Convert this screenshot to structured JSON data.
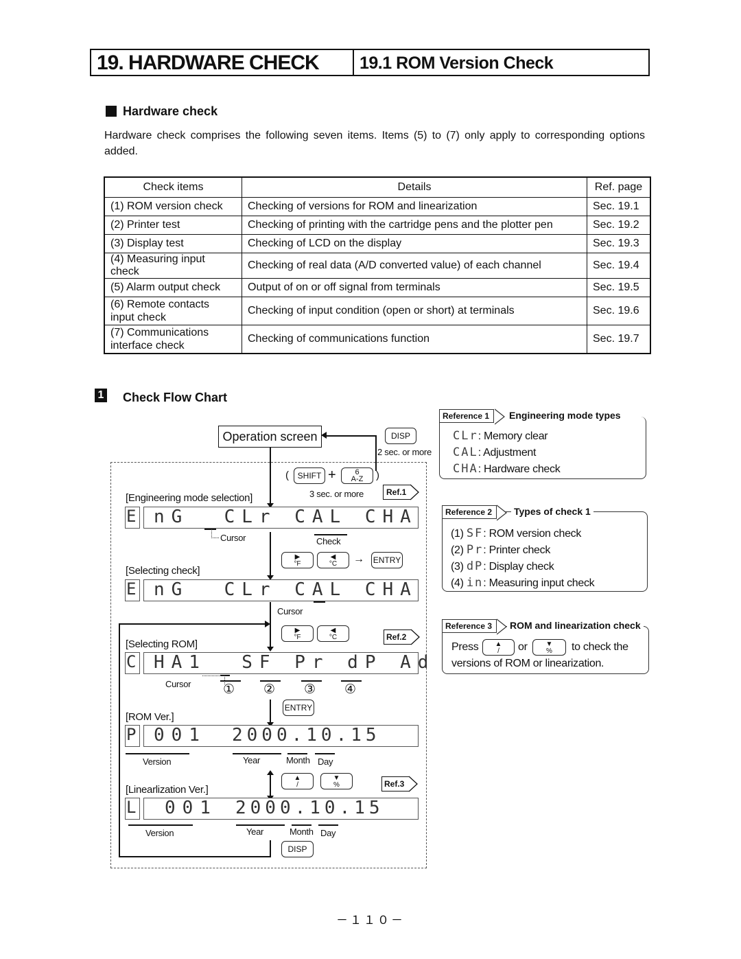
{
  "header": {
    "chapter": "19. HARDWARE CHECK",
    "section": "19.1 ROM Version Check"
  },
  "hardware_check": {
    "heading": "Hardware check",
    "paragraph": "Hardware check comprises the following seven items. Items (5) to (7) only apply to corresponding options added."
  },
  "table": {
    "headers": [
      "Check items",
      "Details",
      "Ref. page"
    ],
    "rows": [
      {
        "item": "(1) ROM version check",
        "details": "Checking of versions for ROM and linearization",
        "ref": "Sec. 19.1"
      },
      {
        "item": "(2) Printer test",
        "details": "Checking of printing with the cartridge pens and the plotter pen",
        "ref": "Sec. 19.2"
      },
      {
        "item": "(3) Display test",
        "details": "Checking of LCD on the display",
        "ref": "Sec. 19.3"
      },
      {
        "item": "(4) Measuring input check",
        "details": "Checking of real data (A/D converted value) of each channel",
        "ref": "Sec. 19.4"
      },
      {
        "item": "(5) Alarm output check",
        "details": "Output of on or off signal from terminals",
        "ref": "Sec. 19.5"
      },
      {
        "item": "(6) Remote contacts input check",
        "details": "Checking of input condition (open or short) at terminals",
        "ref": "Sec. 19.6"
      },
      {
        "item": "(7) Communications interface check",
        "details": "Checking of communications function",
        "ref": "Sec. 19.7"
      }
    ]
  },
  "flow": {
    "section_number": "1",
    "heading": "Check Flow Chart",
    "operation_screen": "Operation screen",
    "disp_key": "DISP",
    "two_sec": "2 sec. or more",
    "shift_key": "SHIFT",
    "plus": "+",
    "az_key_top": "6",
    "az_key_bottom": "A-Z",
    "three_sec": "3 sec. or more",
    "ref1": "Ref.1",
    "ref2": "Ref.2",
    "ref3": "Ref.3",
    "eng_mode_label": "[Engineering mode selection]",
    "lcd1_prefix": "E",
    "lcd1_text": "nG  CLr CAL CHA",
    "cursor": "Cursor",
    "check_label": "Check",
    "f_key": "°F",
    "c_key": "°C",
    "arrow": "→",
    "entry_key": "ENTRY",
    "selecting_check_label": "[Selecting check]",
    "lcd2_prefix": "E",
    "lcd2_text": "nG  CLr CAL CHA",
    "selecting_rom_label": "[Selecting ROM]",
    "lcd3_prefix": "C",
    "lcd3_text": "HA1  SF Pr dP Ad",
    "circled": [
      "①",
      "②",
      "③",
      "④"
    ],
    "rom_ver_label": "[ROM Ver.]",
    "lcd4_prefix": "P",
    "lcd4_version": "001",
    "lcd4_date": "2000.10.15",
    "version_label": "Version",
    "year_label": "Year",
    "month_label": "Month",
    "day_label": "Day",
    "lin_ver_label": "[Linearlization Ver.]",
    "lcd5_prefix": "L",
    "lcd5_version": "001",
    "lcd5_date": "2000.10.15",
    "up_key": "/",
    "down_key": "%"
  },
  "reference1": {
    "tag": "Reference 1",
    "title": "Engineering mode types",
    "items": [
      {
        "code": "CLr",
        "desc": ": Memory clear"
      },
      {
        "code": "CAL",
        "desc": ": Adjustment"
      },
      {
        "code": "CHA",
        "desc": ": Hardware check"
      }
    ]
  },
  "reference2": {
    "tag": "Reference 2",
    "title": "Types of check 1",
    "items": [
      {
        "num": "(1)",
        "code": "SF",
        "desc": ": ROM version check"
      },
      {
        "num": "(2)",
        "code": "Pr",
        "desc": ": Printer check"
      },
      {
        "num": "(3)",
        "code": "dP",
        "desc": ": Display check"
      },
      {
        "num": "(4)",
        "code": "in",
        "desc": ": Measuring input check"
      }
    ]
  },
  "reference3": {
    "tag": "Reference 3",
    "title": "ROM and linearization check",
    "press": "Press",
    "or": "or",
    "to_check": "to check the",
    "line2": "versions of ROM or linearization."
  },
  "page_number": "－１１０－"
}
